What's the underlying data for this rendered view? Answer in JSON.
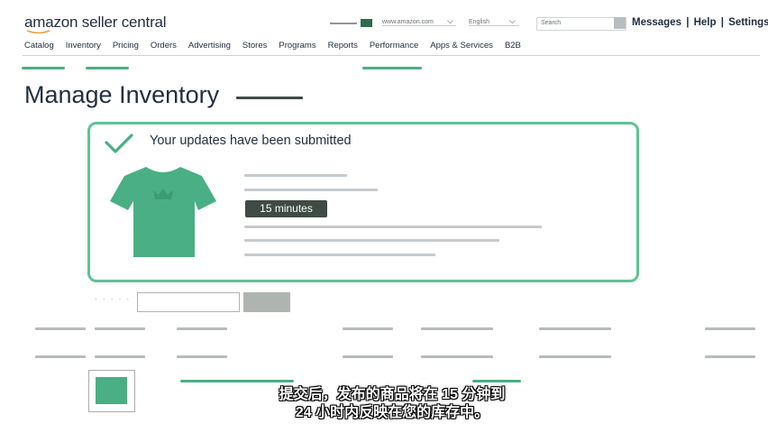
{
  "header": {
    "logo_text": "amazon seller central",
    "marketplace": "www.amazon.com",
    "language": "English",
    "search_placeholder": "Search",
    "links": [
      "Messages",
      "Help",
      "Settings"
    ],
    "separator": "|"
  },
  "nav": [
    "Catalog",
    "Inventory",
    "Pricing",
    "Orders",
    "Advertising",
    "Stores",
    "Programs",
    "Reports",
    "Performance",
    "Apps & Services",
    "B2B"
  ],
  "page": {
    "title": "Manage Inventory"
  },
  "notification": {
    "message": "Your updates have been submitted",
    "time_badge": "15 minutes"
  },
  "subtitle": {
    "line1": "提交后，发布的商品将在 15 分钟到",
    "line2": "24 小时内反映在您的库存中。"
  },
  "colors": {
    "accent": "#4aaf85",
    "text": "#232f3e",
    "border": "#5ec397",
    "badge": "#3f4b44"
  }
}
